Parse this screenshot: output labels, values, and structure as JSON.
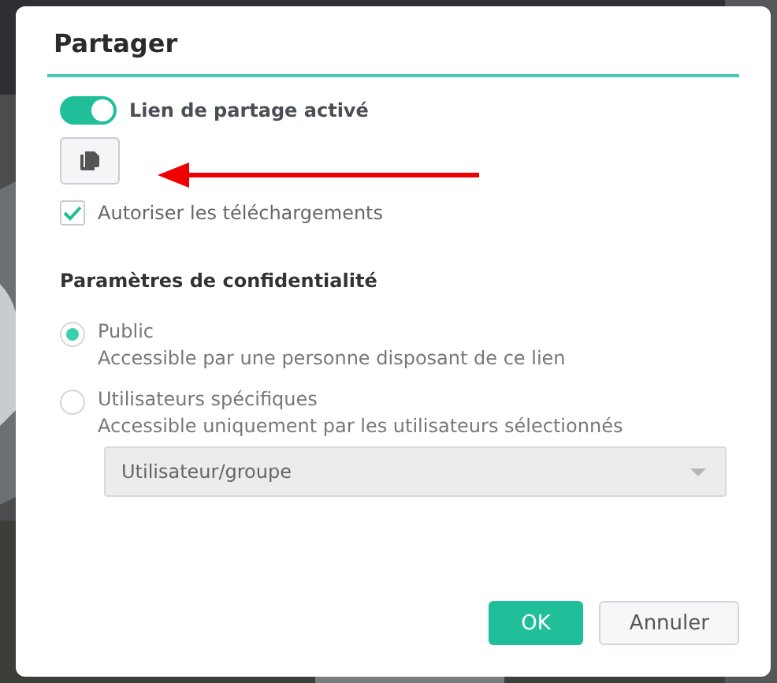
{
  "dialog": {
    "title": "Partager",
    "share_link": {
      "label": "Lien de partage activé",
      "on": true
    },
    "allow_downloads": {
      "label": "Autoriser les téléchargements",
      "checked": true
    },
    "privacy": {
      "heading": "Paramètres de confidentialité",
      "options": [
        {
          "label": "Public",
          "description": "Accessible par une personne disposant de ce lien",
          "selected": true
        },
        {
          "label": "Utilisateurs spécifiques",
          "description": "Accessible uniquement par les utilisateurs sélectionnés",
          "selected": false
        }
      ],
      "user_select": {
        "placeholder": "Utilisateur/groupe",
        "disabled": true
      }
    },
    "buttons": [
      {
        "label": "OK",
        "kind": "primary"
      },
      {
        "label": "Annuler",
        "kind": "secondary"
      }
    ]
  }
}
